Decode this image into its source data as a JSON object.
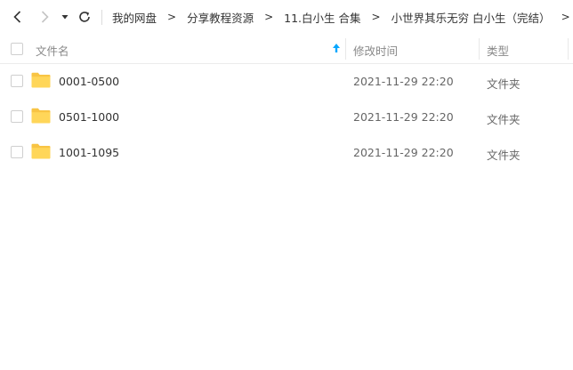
{
  "toolbar": {
    "icons": {
      "back": "chevron-left-icon",
      "forward": "chevron-right-icon",
      "history": "dropdown-arrow-icon",
      "refresh": "refresh-icon"
    },
    "breadcrumbs": [
      {
        "label": "我的网盘"
      },
      {
        "label": "分享教程资源"
      },
      {
        "label": "11.白小生 合集"
      },
      {
        "label": "小世界其乐无穷 白小生（完结）"
      }
    ],
    "separator": ">"
  },
  "header": {
    "name_label": "文件名",
    "modified_label": "修改时间",
    "type_label": "类型",
    "sort_icon": "sort-up-arrow-icon",
    "accent": "#06a7ff"
  },
  "files": [
    {
      "name": "0001-0500",
      "modified": "2021-11-29 22:20",
      "type": "文件夹"
    },
    {
      "name": "0501-1000",
      "modified": "2021-11-29 22:20",
      "type": "文件夹"
    },
    {
      "name": "1001-1095",
      "modified": "2021-11-29 22:20",
      "type": "文件夹"
    }
  ],
  "colors": {
    "folder": "#ffd659",
    "folder_tab": "#f8c444",
    "text": "#333333",
    "muted": "#888888"
  }
}
